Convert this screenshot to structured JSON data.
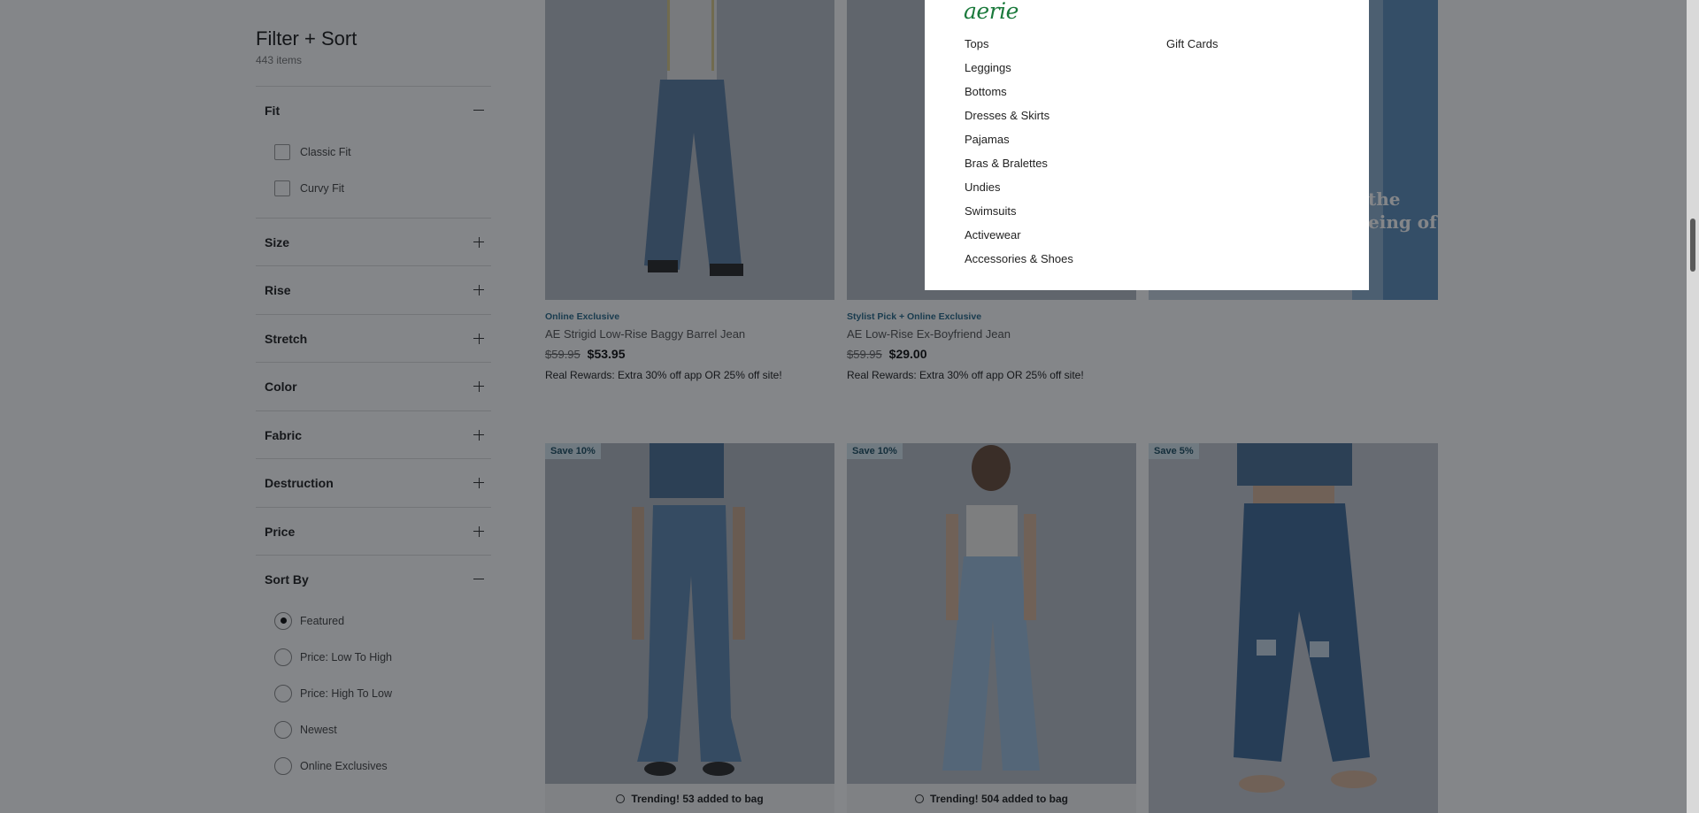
{
  "filter": {
    "title": "Filter + Sort",
    "count": "443 items",
    "fit": {
      "label": "Fit",
      "options": [
        "Classic Fit",
        "Curvy Fit"
      ]
    },
    "sections": [
      "Size",
      "Rise",
      "Stretch",
      "Color",
      "Fabric",
      "Destruction",
      "Price"
    ],
    "sort": {
      "label": "Sort By",
      "options": [
        "Featured",
        "Price: Low To High",
        "Price: High To Low",
        "Newest",
        "Online Exclusives"
      ],
      "selected": "Featured"
    }
  },
  "products": [
    {
      "eyebrow": "Online Exclusive",
      "name": "AE Strigid Low-Rise Baggy Barrel Jean",
      "was": "$59.95",
      "now": "$53.95",
      "promo": "Real Rewards: Extra 30% off app OR 25% off site!"
    },
    {
      "eyebrow": "Stylist Pick + Online Exclusive",
      "name": "AE Low-Rise Ex-Boyfriend Jean",
      "was": "$59.95",
      "now": "$29.00",
      "promo": "Real Rewards: Extra 30% off app OR 25% off site!"
    }
  ],
  "badges": [
    "Save 10%",
    "Save 10%",
    "Save 5%"
  ],
  "trending": [
    "Trending! 53 added to bag",
    "Trending! 504 added to bag"
  ],
  "promo_banner_text": [
    "the",
    "eing of"
  ],
  "flyout": {
    "brand": "aerie",
    "menu": [
      "Tops",
      "Leggings",
      "Bottoms",
      "Dresses & Skirts",
      "Pajamas",
      "Bras & Bralettes",
      "Undies",
      "Swimsuits",
      "Activewear",
      "Accessories & Shoes"
    ],
    "menu2": [
      "Gift Cards"
    ]
  }
}
